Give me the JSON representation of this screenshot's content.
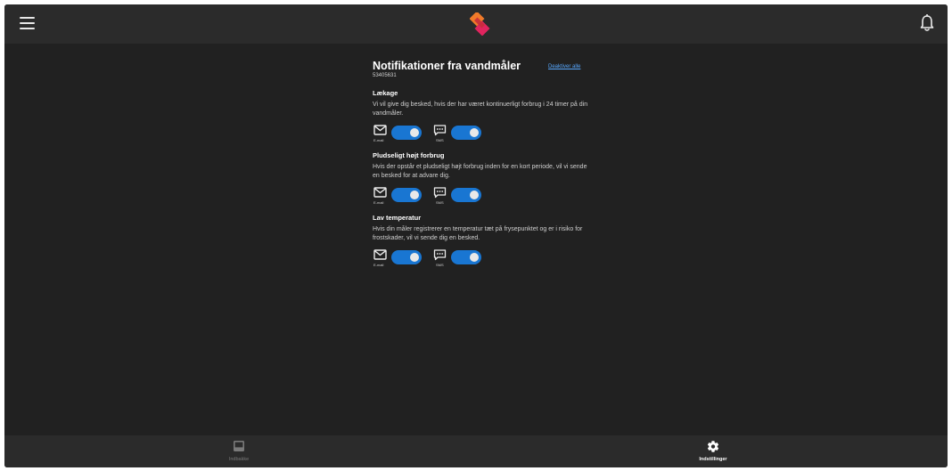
{
  "header": {
    "menu_icon": "hamburger-menu-icon",
    "logo_icon": "diamond-logo-icon",
    "notification_icon": "bell-icon"
  },
  "page": {
    "title": "Notifikationer fra vandmåler",
    "meter_id": "53405631",
    "deactivate_all": "Deaktiver alle"
  },
  "sections": [
    {
      "heading": "Lækage",
      "text": "Vi vil give dig besked, hvis der har været kontinuerligt forbrug i 24 timer på din vandmåler.",
      "email_label": "E-mail",
      "sms_label": "SMS",
      "email_on": true,
      "sms_on": true
    },
    {
      "heading": "Pludseligt højt forbrug",
      "text": "Hvis der opstår et pludseligt højt forbrug inden for en kort periode, vil vi sende en besked for at advare dig.",
      "email_label": "E-mail",
      "sms_label": "SMS",
      "email_on": true,
      "sms_on": true
    },
    {
      "heading": "Lav temperatur",
      "text": "Hvis din måler registrerer en temperatur tæt på frysepunktet og er i risiko for frostskader, vil vi sende dig en besked.",
      "email_label": "E-mail",
      "sms_label": "SMS",
      "email_on": true,
      "sms_on": true
    }
  ],
  "bottom_nav": {
    "inbox_label": "Indbakke",
    "settings_label": "Indstillinger",
    "active": "Indstillinger"
  },
  "colors": {
    "background": "#212121",
    "bar": "#2b2b2b",
    "toggle_on": "#1976d2",
    "link": "#57a8ff",
    "logo_orange": "#f07a2a",
    "logo_pink": "#e0245e"
  }
}
